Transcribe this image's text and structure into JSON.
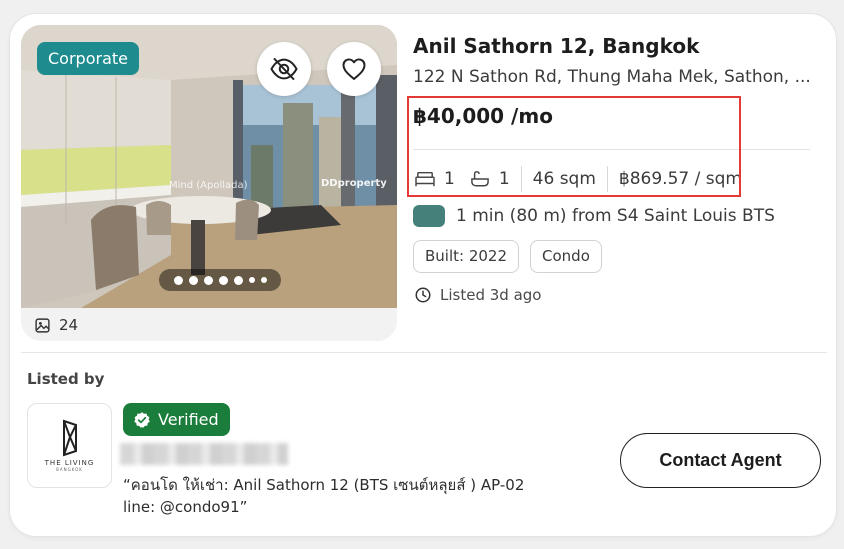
{
  "listing": {
    "badge": "Corporate",
    "photo_count": "24",
    "watermark_text": "Mind (Apollada)",
    "watermark_brand": "DDproperty",
    "title": "Anil Sathorn 12, Bangkok",
    "address": "122 N Sathon Rd, Thung Maha Mek, Sathon, ...",
    "price": "฿40,000 /mo",
    "specs": {
      "bedrooms": "1",
      "bathrooms": "1",
      "area": "46 sqm",
      "price_per_sqm": "฿869.57 / sqm"
    },
    "transit": "1 min (80 m) from S4 Saint Louis BTS",
    "tags": [
      "Built: 2022",
      "Condo"
    ],
    "listed": "Listed 3d ago",
    "gallery": {
      "total_dots": 7,
      "active_index": 0
    }
  },
  "agent": {
    "section_label": "Listed by",
    "logo_text": "THE LIVING",
    "logo_subtext": "BANGKOK",
    "verified_label": "Verified",
    "description": "“คอนโด ให้เช่า: Anil Sathorn 12 (BTS เซนต์หลุยส์ ) AP-02 line: @condo91”",
    "contact_label": "Contact Agent"
  },
  "colors": {
    "corporate_badge": "#1e8c8f",
    "verified_badge": "#1b7d3c",
    "transit_line": "#45807a",
    "highlight": "#e53935"
  },
  "icons": {
    "hide": "eye-off-icon",
    "favorite": "heart-icon",
    "photos": "image-icon",
    "bed": "bed-icon",
    "bath": "bathtub-icon",
    "clock": "clock-icon",
    "verified": "check-badge-icon"
  }
}
